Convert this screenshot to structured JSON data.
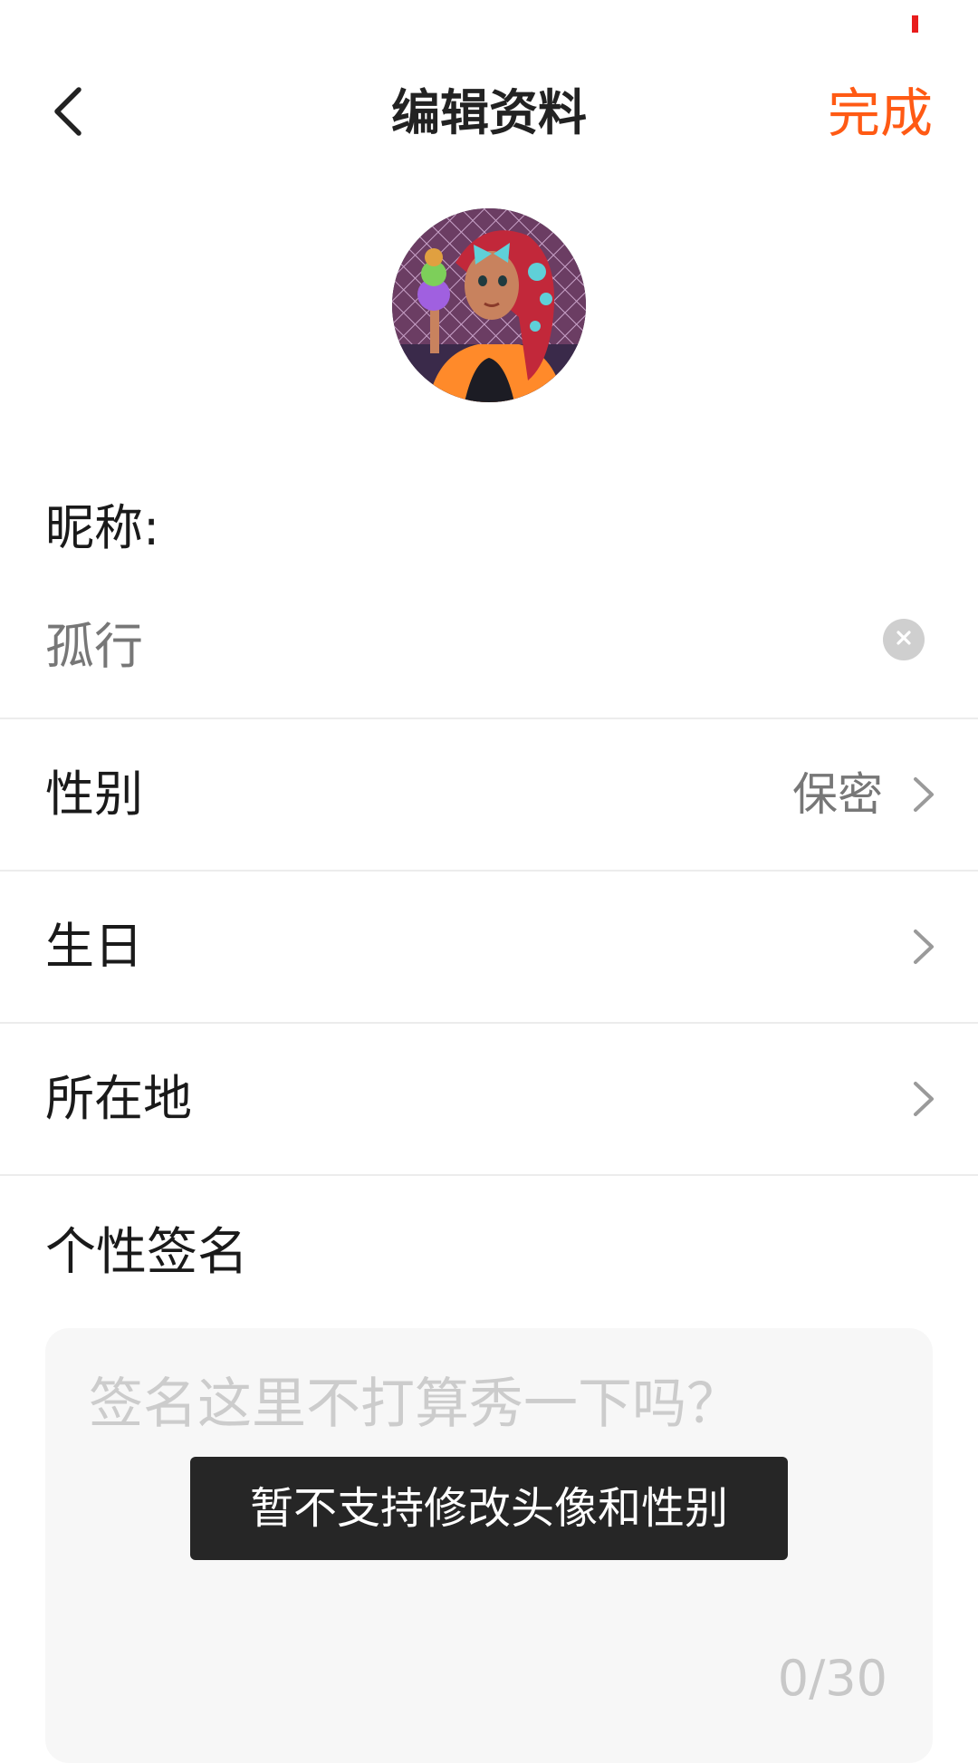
{
  "status_bar": {
    "indicator_color": "#e81c1c"
  },
  "header": {
    "title": "编辑资料",
    "back_icon": "chevron-left-icon",
    "done_label": "完成",
    "done_color": "#ff5a14"
  },
  "avatar": {
    "description_icon": "user-avatar-image"
  },
  "nickname": {
    "label": "昵称:",
    "value": "孤行",
    "clear_icon": "close-circle-icon"
  },
  "rows": [
    {
      "label": "性别",
      "value": "保密",
      "icon": "chevron-right-icon"
    },
    {
      "label": "生日",
      "value": "",
      "icon": "chevron-right-icon"
    },
    {
      "label": "所在地",
      "value": "",
      "icon": "chevron-right-icon"
    }
  ],
  "signature": {
    "label": "个性签名",
    "placeholder": "签名这里不打算秀一下吗？",
    "char_count": "0/30"
  },
  "toast": {
    "message": "暂不支持修改头像和性别"
  }
}
